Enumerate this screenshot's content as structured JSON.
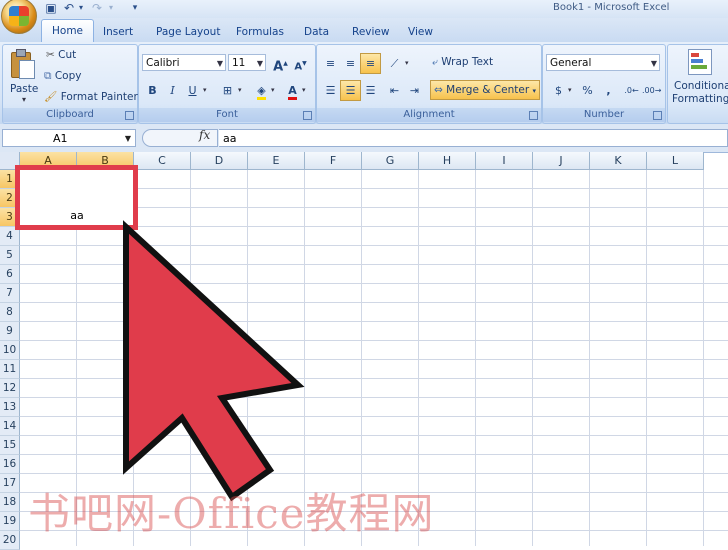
{
  "window": {
    "title": "Book1 - Microsoft Excel"
  },
  "quick_access": {
    "icons": [
      "save-icon",
      "undo-icon",
      "redo-icon",
      "customize-icon"
    ]
  },
  "tabs": [
    {
      "label": "Home",
      "active": true
    },
    {
      "label": "Insert"
    },
    {
      "label": "Page Layout"
    },
    {
      "label": "Formulas"
    },
    {
      "label": "Data"
    },
    {
      "label": "Review"
    },
    {
      "label": "View"
    }
  ],
  "ribbon": {
    "clipboard": {
      "label": "Clipboard",
      "paste": "Paste",
      "cut": "Cut",
      "copy": "Copy",
      "format_painter": "Format Painter"
    },
    "font": {
      "label": "Font",
      "font_name": "Calibri",
      "font_size": "11",
      "bold": "B",
      "italic": "I",
      "underline": "U",
      "grow": "A",
      "shrink": "A",
      "font_color_glyph": "A"
    },
    "alignment": {
      "label": "Alignment",
      "wrap_text": "Wrap Text",
      "merge_center": "Merge & Center"
    },
    "number": {
      "label": "Number",
      "format": "General",
      "currency": "$",
      "percent": "%",
      "comma": ","
    },
    "styles": {
      "conditional_1": "Conditional",
      "conditional_2": "Formatting"
    }
  },
  "formula_bar": {
    "name_box": "A1",
    "fx": "fx",
    "content": "aa"
  },
  "grid": {
    "columns": [
      "A",
      "B",
      "C",
      "D",
      "E",
      "F",
      "G",
      "H",
      "I",
      "J",
      "K",
      "L"
    ],
    "rows": [
      "1",
      "2",
      "3",
      "4",
      "5",
      "6",
      "7",
      "8",
      "9",
      "10",
      "11",
      "12",
      "13",
      "14",
      "15",
      "16",
      "17",
      "18",
      "19",
      "20"
    ],
    "selected_columns": [
      "A",
      "B"
    ],
    "selected_rows": [
      "1",
      "2",
      "3"
    ],
    "merged_cell_text": "aa"
  },
  "overlay": {
    "highlight_color": "#e03c4b",
    "arrow_color": "#e03c4b"
  },
  "watermark": "书吧网-Office教程网"
}
